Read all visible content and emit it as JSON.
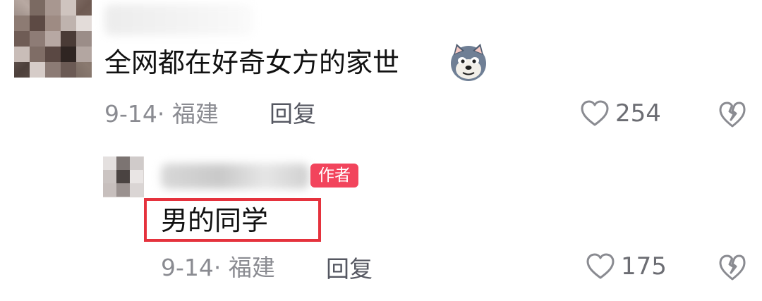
{
  "main_comment": {
    "text": "全网都在好奇女方的家世",
    "emoji": "doge-icon",
    "date_location": "9-14· 福建",
    "reply_label": "回复",
    "likes": "254"
  },
  "reply_comment": {
    "badge": "作者",
    "text": "男的同学",
    "date_location": "9-14· 福建",
    "reply_label": "回复",
    "likes": "175"
  },
  "colors": {
    "badge": "#f2445c",
    "highlight": "#e5323d",
    "meta": "#8a8b91"
  }
}
